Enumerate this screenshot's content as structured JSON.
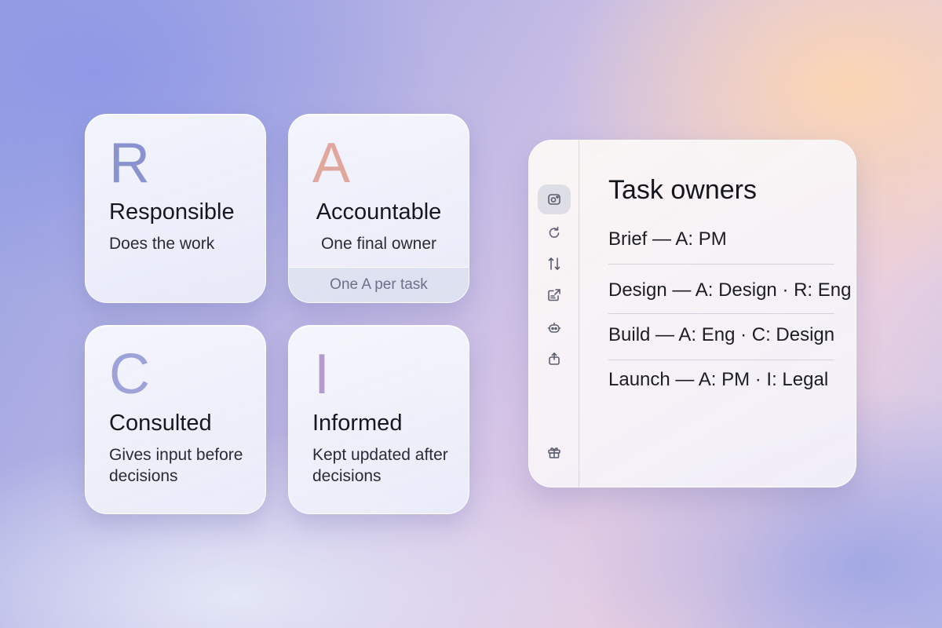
{
  "cards": {
    "r": {
      "letter": "R",
      "title": "Responsible",
      "desc": "Does the work",
      "letter_color": "#8a93cf"
    },
    "a": {
      "letter": "A",
      "title": "Accountable",
      "desc": "One final owner",
      "note": "One A per task",
      "letter_color": "#e2a79c"
    },
    "c": {
      "letter": "C",
      "title": "Consulted",
      "desc": "Gives input before decisions",
      "letter_color": "#9ea2d8"
    },
    "i": {
      "letter": "I",
      "title": "Informed",
      "desc": "Kept updated after decisions",
      "letter_color": "#b59acc"
    }
  },
  "panel": {
    "title": "Task owners",
    "rows": [
      "Brief — A: PM",
      "Design — A: Design · R: Eng",
      "Build  — A: Eng · C: Design",
      "Launch — A: PM · I: Legal"
    ],
    "rail_icons": [
      "camera-settings-icon",
      "refresh-icon",
      "sort-icon",
      "export-icon",
      "robot-icon",
      "share-icon",
      "gift-icon"
    ]
  }
}
